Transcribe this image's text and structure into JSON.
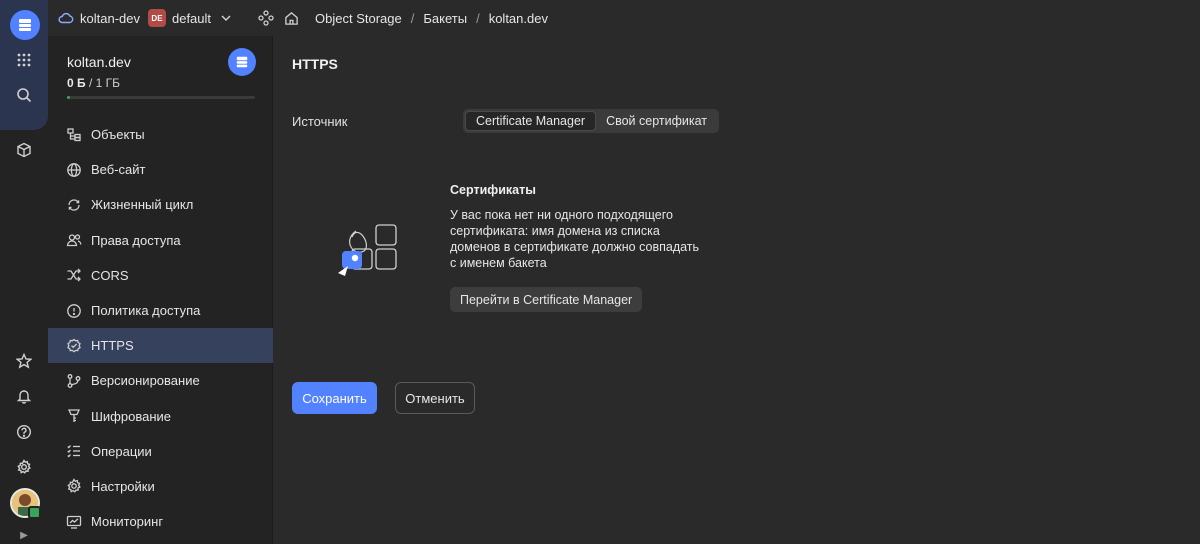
{
  "topbar": {
    "cloud_name": "koltan-dev",
    "folder_badge": "DE",
    "folder_name": "default",
    "breadcrumbs": [
      "Object Storage",
      "Бакеты",
      "koltan.dev"
    ],
    "separator": "/"
  },
  "sidebar": {
    "bucket_name": "koltan.dev",
    "size_used": "0 Б",
    "size_sep": " / ",
    "size_total": "1 ГБ",
    "usage_fraction": 0.01,
    "items": [
      {
        "label": "Объекты",
        "icon": "objects-icon"
      },
      {
        "label": "Веб-сайт",
        "icon": "globe-icon"
      },
      {
        "label": "Жизненный цикл",
        "icon": "lifecycle-icon"
      },
      {
        "label": "Права доступа",
        "icon": "users-icon"
      },
      {
        "label": "CORS",
        "icon": "shuffle-icon"
      },
      {
        "label": "Политика доступа",
        "icon": "shield-icon"
      },
      {
        "label": "HTTPS",
        "icon": "shield-check-icon",
        "active": true
      },
      {
        "label": "Версионирование",
        "icon": "branch-icon"
      },
      {
        "label": "Шифрование",
        "icon": "key-icon"
      },
      {
        "label": "Операции",
        "icon": "list-icon"
      },
      {
        "label": "Настройки",
        "icon": "gear-icon"
      },
      {
        "label": "Мониторинг",
        "icon": "monitor-icon"
      }
    ]
  },
  "main": {
    "title": "HTTPS",
    "source_label": "Источник",
    "source_options": [
      "Certificate Manager",
      "Свой сертификат"
    ],
    "source_selected": "Certificate Manager",
    "certs_title": "Сертификаты",
    "certs_text": "У вас пока нет ни одного подходящего сертификата: имя домена из списка доменов в сертификате должно совпадать с именем бакета",
    "goto_button": "Перейти в Certificate Manager",
    "save_button": "Сохранить",
    "cancel_button": "Отменить"
  },
  "colors": {
    "accent": "#5282ff",
    "background": "#2a2a2a",
    "sidebar": "#232323",
    "active_item": "#36415e",
    "usage_bar": "#3aa35a",
    "folder_badge": "#b24b45"
  }
}
